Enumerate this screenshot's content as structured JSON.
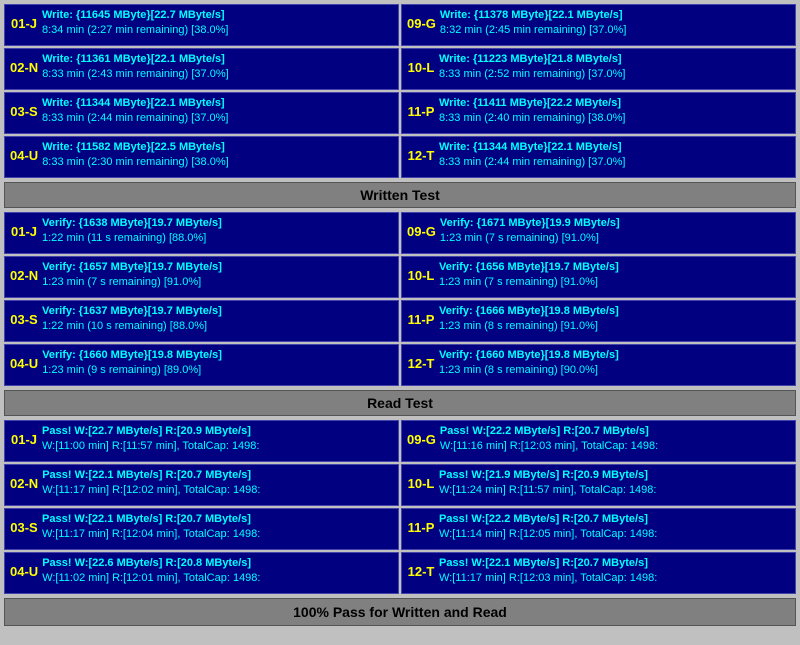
{
  "sections": {
    "written_test": {
      "header": "Written Test",
      "left_items": [
        {
          "label": "01-J",
          "line1": "Write: {11645 MByte}[22.7 MByte/s]",
          "line2": "8:34 min (2:27 min remaining)  [38.0%]"
        },
        {
          "label": "02-N",
          "line1": "Write: {11361 MByte}[22.1 MByte/s]",
          "line2": "8:33 min (2:43 min remaining)  [37.0%]"
        },
        {
          "label": "03-S",
          "line1": "Write: {11344 MByte}[22.1 MByte/s]",
          "line2": "8:33 min (2:44 min remaining)  [37.0%]"
        },
        {
          "label": "04-U",
          "line1": "Write: {11582 MByte}[22.5 MByte/s]",
          "line2": "8:33 min (2:30 min remaining)  [38.0%]"
        }
      ],
      "right_items": [
        {
          "label": "09-G",
          "line1": "Write: {11378 MByte}[22.1 MByte/s]",
          "line2": "8:32 min (2:45 min remaining)  [37.0%]"
        },
        {
          "label": "10-L",
          "line1": "Write: {11223 MByte}[21.8 MByte/s]",
          "line2": "8:33 min (2:52 min remaining)  [37.0%]"
        },
        {
          "label": "11-P",
          "line1": "Write: {11411 MByte}[22.2 MByte/s]",
          "line2": "8:33 min (2:40 min remaining)  [38.0%]"
        },
        {
          "label": "12-T",
          "line1": "Write: {11344 MByte}[22.1 MByte/s]",
          "line2": "8:33 min (2:44 min remaining)  [37.0%]"
        }
      ]
    },
    "verify_test": {
      "header": "Written Test",
      "left_items": [
        {
          "label": "01-J",
          "line1": "Verify: {1638 MByte}[19.7 MByte/s]",
          "line2": "1:22 min (11 s remaining)  [88.0%]"
        },
        {
          "label": "02-N",
          "line1": "Verify: {1657 MByte}[19.7 MByte/s]",
          "line2": "1:23 min (7 s remaining)  [91.0%]"
        },
        {
          "label": "03-S",
          "line1": "Verify: {1637 MByte}[19.7 MByte/s]",
          "line2": "1:22 min (10 s remaining)  [88.0%]"
        },
        {
          "label": "04-U",
          "line1": "Verify: {1660 MByte}[19.8 MByte/s]",
          "line2": "1:23 min (9 s remaining)  [89.0%]"
        }
      ],
      "right_items": [
        {
          "label": "09-G",
          "line1": "Verify: {1671 MByte}[19.9 MByte/s]",
          "line2": "1:23 min (7 s remaining)  [91.0%]"
        },
        {
          "label": "10-L",
          "line1": "Verify: {1656 MByte}[19.7 MByte/s]",
          "line2": "1:23 min (7 s remaining)  [91.0%]"
        },
        {
          "label": "11-P",
          "line1": "Verify: {1666 MByte}[19.8 MByte/s]",
          "line2": "1:23 min (8 s remaining)  [91.0%]"
        },
        {
          "label": "12-T",
          "line1": "Verify: {1660 MByte}[19.8 MByte/s]",
          "line2": "1:23 min (8 s remaining)  [90.0%]"
        }
      ]
    },
    "read_test": {
      "header": "Read Test",
      "left_items": [
        {
          "label": "01-J",
          "line1": "Pass! W:[22.7 MByte/s] R:[20.9 MByte/s]",
          "line2": "W:[11:00 min] R:[11:57 min], TotalCap: 1498:"
        },
        {
          "label": "02-N",
          "line1": "Pass! W:[22.1 MByte/s] R:[20.7 MByte/s]",
          "line2": "W:[11:17 min] R:[12:02 min], TotalCap: 1498:"
        },
        {
          "label": "03-S",
          "line1": "Pass! W:[22.1 MByte/s] R:[20.7 MByte/s]",
          "line2": "W:[11:17 min] R:[12:04 min], TotalCap: 1498:"
        },
        {
          "label": "04-U",
          "line1": "Pass! W:[22.6 MByte/s] R:[20.8 MByte/s]",
          "line2": "W:[11:02 min] R:[12:01 min], TotalCap: 1498:"
        }
      ],
      "right_items": [
        {
          "label": "09-G",
          "line1": "Pass! W:[22.2 MByte/s] R:[20.7 MByte/s]",
          "line2": "W:[11:16 min] R:[12:03 min], TotalCap: 1498:"
        },
        {
          "label": "10-L",
          "line1": "Pass! W:[21.9 MByte/s] R:[20.9 MByte/s]",
          "line2": "W:[11:24 min] R:[11:57 min], TotalCap: 1498:"
        },
        {
          "label": "11-P",
          "line1": "Pass! W:[22.2 MByte/s] R:[20.7 MByte/s]",
          "line2": "W:[11:14 min] R:[12:05 min], TotalCap: 1498:"
        },
        {
          "label": "12-T",
          "line1": "Pass! W:[22.1 MByte/s] R:[20.7 MByte/s]",
          "line2": "W:[11:17 min] R:[12:03 min], TotalCap: 1498:"
        }
      ]
    }
  },
  "footer": "100% Pass for Written and Read"
}
